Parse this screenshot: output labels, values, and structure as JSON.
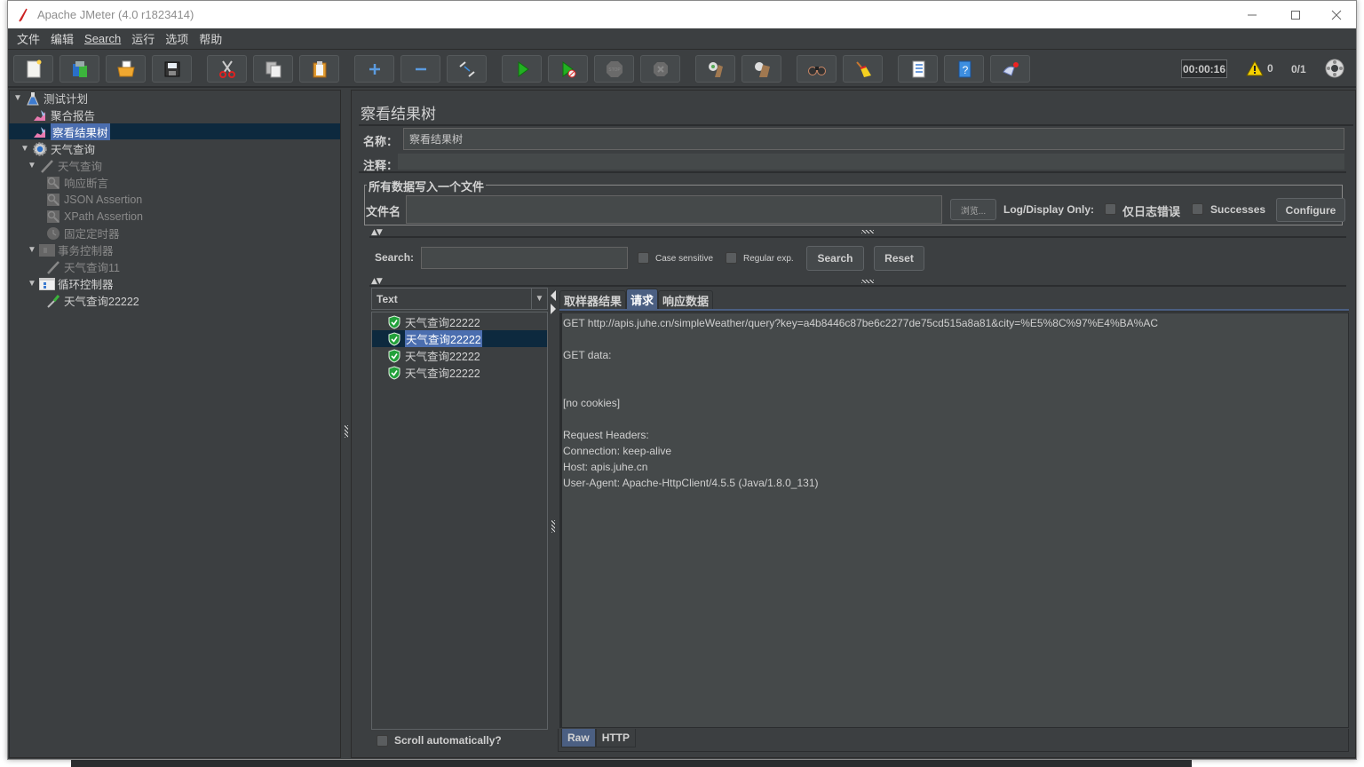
{
  "window": {
    "title": "Apache JMeter (4.0 r1823414)",
    "controls": [
      "minimize",
      "maximize",
      "close"
    ]
  },
  "menu": [
    {
      "label": "文件"
    },
    {
      "label": "编辑"
    },
    {
      "label": "Search",
      "mnemonic": "S"
    },
    {
      "label": "运行"
    },
    {
      "label": "选项"
    },
    {
      "label": "帮助"
    }
  ],
  "toolbar": {
    "buttons": [
      {
        "name": "new",
        "icon": "new-file-icon"
      },
      {
        "name": "templates",
        "icon": "templates-icon"
      },
      {
        "name": "open",
        "icon": "open-folder-icon"
      },
      {
        "name": "save",
        "icon": "save-disk-icon"
      },
      {
        "name": "cut",
        "icon": "scissors-icon"
      },
      {
        "name": "copy",
        "icon": "copy-icon"
      },
      {
        "name": "paste",
        "icon": "clipboard-icon"
      },
      {
        "name": "expand",
        "icon": "plus-icon"
      },
      {
        "name": "collapse",
        "icon": "minus-icon"
      },
      {
        "name": "toggle",
        "icon": "toggle-icon"
      },
      {
        "name": "start",
        "icon": "play-icon"
      },
      {
        "name": "start-no-pauses",
        "icon": "play-no-timers-icon"
      },
      {
        "name": "stop",
        "icon": "stop-icon"
      },
      {
        "name": "shutdown",
        "icon": "shutdown-icon"
      },
      {
        "name": "clear",
        "icon": "clear-icon"
      },
      {
        "name": "clear-all",
        "icon": "clear-all-icon"
      },
      {
        "name": "search",
        "icon": "binoculars-icon"
      },
      {
        "name": "reset-search",
        "icon": "broom-icon"
      },
      {
        "name": "function-helper",
        "icon": "list-icon"
      },
      {
        "name": "help",
        "icon": "help-book-icon"
      },
      {
        "name": "remote",
        "icon": "remote-icon"
      }
    ],
    "timer": "00:00:16",
    "warnings": "0",
    "threads": "0/1",
    "status_icon": "globe-icon"
  },
  "tree": {
    "items": [
      {
        "label": "测试计划",
        "icon": "flask-icon",
        "level": 0,
        "expanded": true
      },
      {
        "label": "聚合报告",
        "icon": "graph-icon",
        "level": 1
      },
      {
        "label": "察看结果树",
        "icon": "graph-icon",
        "level": 1,
        "selected": true
      },
      {
        "label": "天气查询",
        "icon": "gear-icon",
        "level": 0,
        "expanded": true
      },
      {
        "label": "天气查询",
        "icon": "pipette-icon",
        "level": 1,
        "expanded": true,
        "disabled": true
      },
      {
        "label": "响应断言",
        "icon": "magnifier-icon",
        "level": 2,
        "disabled": true
      },
      {
        "label": "JSON Assertion",
        "icon": "magnifier-icon",
        "level": 2,
        "disabled": true
      },
      {
        "label": "XPath Assertion",
        "icon": "magnifier-icon",
        "level": 2,
        "disabled": true
      },
      {
        "label": "固定定时器",
        "icon": "clock-icon",
        "level": 2,
        "disabled": true
      },
      {
        "label": "事务控制器",
        "icon": "controller-icon",
        "level": 1,
        "expanded": true,
        "disabled": true
      },
      {
        "label": "天气查询11",
        "icon": "pipette-icon",
        "level": 2,
        "disabled": true
      },
      {
        "label": "循环控制器",
        "icon": "loop-controller-icon",
        "level": 1,
        "expanded": true
      },
      {
        "label": "天气查询22222",
        "icon": "pipette-green-icon",
        "level": 2
      }
    ]
  },
  "panel": {
    "title": "察看结果树",
    "name_label": "名称：",
    "name_value": "察看结果树",
    "comment_label": "注释：",
    "comment_value": "",
    "file_group_title": "所有数据写入一个文件",
    "filename_label": "文件名",
    "filename_value": "",
    "browse_label": "浏览...",
    "log_display_label": "Log/Display Only:",
    "errors_only_label": "仅日志错误",
    "errors_only_checked": false,
    "successes_label": "Successes",
    "successes_checked": false,
    "configure_label": "Configure"
  },
  "search": {
    "label": "Search:",
    "value": "",
    "case_sensitive_label": "Case sensitive",
    "case_sensitive_checked": false,
    "regex_label": "Regular exp.",
    "regex_checked": false,
    "search_button": "Search",
    "reset_button": "Reset"
  },
  "results": {
    "renderer": "Text",
    "items": [
      {
        "label": "天气查询22222",
        "status": "success"
      },
      {
        "label": "天气查询22222",
        "status": "success",
        "selected": true
      },
      {
        "label": "天气查询22222",
        "status": "success"
      },
      {
        "label": "天气查询22222",
        "status": "success"
      }
    ],
    "scroll_auto_label": "Scroll automatically?",
    "scroll_auto_checked": false
  },
  "detail": {
    "tabs": [
      {
        "label": "取样器结果"
      },
      {
        "label": "请求",
        "active": true
      },
      {
        "label": "响应数据"
      }
    ],
    "lines": [
      "GET http://apis.juhe.cn/simpleWeather/query?key=a4b8446c87be6c2277de75cd515a8a81&city=%E5%8C%97%E4%BA%AC",
      "",
      "GET data:",
      "",
      "",
      "[no cookies]",
      "",
      "Request Headers:",
      "Connection: keep-alive",
      "Host: apis.juhe.cn",
      "User-Agent: Apache-HttpClient/4.5.5 (Java/1.8.0_131)"
    ],
    "bottom_tabs": [
      {
        "label": "Raw",
        "active": true
      },
      {
        "label": "HTTP"
      }
    ]
  }
}
